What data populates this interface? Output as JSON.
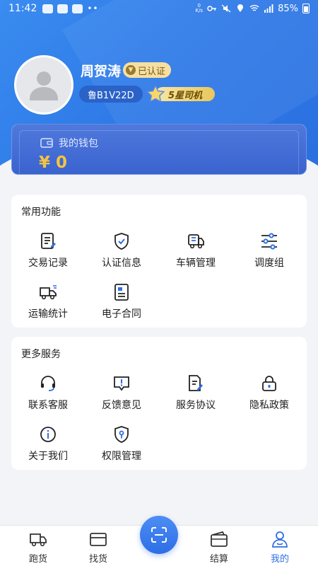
{
  "status_bar": {
    "time": "11:42",
    "speed_top": "0",
    "speed_unit": "K/s",
    "battery": "85%"
  },
  "profile": {
    "name": "周贺涛",
    "verified_label": "已认证",
    "plate": "鲁B1V22D",
    "rating_label": "5星司机"
  },
  "wallet": {
    "title": "我的钱包",
    "amount": "¥ 0"
  },
  "common_functions": {
    "title": "常用功能",
    "items": [
      {
        "label": "交易记录",
        "icon": "document-edit-icon"
      },
      {
        "label": "认证信息",
        "icon": "shield-check-icon"
      },
      {
        "label": "车辆管理",
        "icon": "truck-front-icon"
      },
      {
        "label": "调度组",
        "icon": "sliders-icon"
      },
      {
        "label": "运输统计",
        "icon": "delivery-truck-icon"
      },
      {
        "label": "电子合同",
        "icon": "contract-icon"
      }
    ]
  },
  "more_services": {
    "title": "更多服务",
    "items": [
      {
        "label": "联系客服",
        "icon": "headset-icon"
      },
      {
        "label": "反馈意见",
        "icon": "feedback-icon"
      },
      {
        "label": "服务协议",
        "icon": "agreement-icon"
      },
      {
        "label": "隐私政策",
        "icon": "lock-icon"
      },
      {
        "label": "关于我们",
        "icon": "info-icon"
      },
      {
        "label": "权限管理",
        "icon": "permission-icon"
      }
    ]
  },
  "tab_bar": {
    "items": [
      {
        "label": "跑货",
        "icon": "truck-icon"
      },
      {
        "label": "找货",
        "icon": "cargo-box-icon"
      },
      {
        "label": "",
        "icon": "scan-icon"
      },
      {
        "label": "结算",
        "icon": "wallet-icon"
      },
      {
        "label": "我的",
        "icon": "user-icon"
      }
    ],
    "active": "我的"
  },
  "colors": {
    "primary": "#2f6fe3",
    "wallet_amount": "#f5c341",
    "badge_gold": "#f6dfa2"
  }
}
